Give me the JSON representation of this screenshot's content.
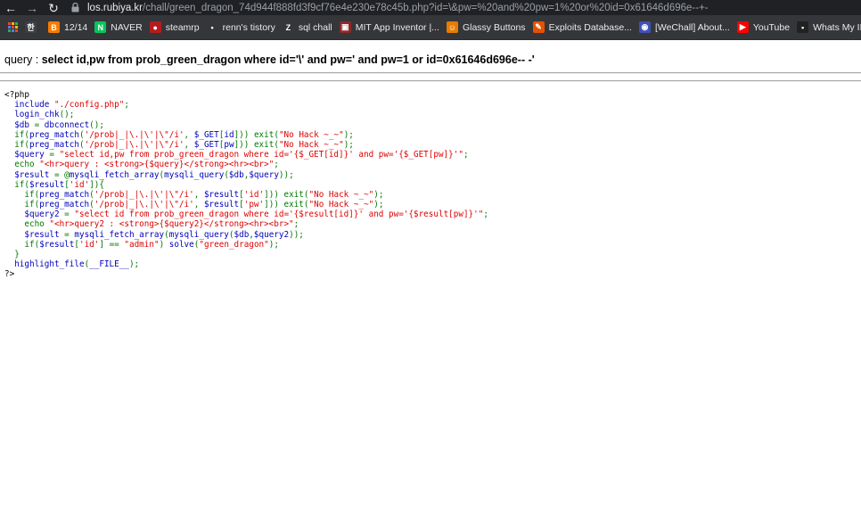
{
  "browser": {
    "url_host": "los.rubiya.kr",
    "url_rest": "/chall/green_dragon_74d944f888fd3f9cf76e4e230e78c45b.php?id=\\&pw=%20and%20pw=1%20or%20id=0x61646d696e--+-",
    "bookmarks": [
      {
        "label": "",
        "icon": "apps-grid-icon"
      },
      {
        "label": "",
        "icon": "korean-icon",
        "glyph": "한",
        "color": "#3c4043"
      },
      {
        "label": "12/14",
        "icon": "blogger-icon",
        "glyph": "B",
        "color": "#f57c00"
      },
      {
        "label": "NAVER",
        "icon": "naver-icon",
        "glyph": "N",
        "color": "#03c75a"
      },
      {
        "label": "steamrp",
        "icon": "steam-icon",
        "glyph": "●",
        "color": "#b71c1c"
      },
      {
        "label": "renn's tistory",
        "icon": "tistory-icon",
        "glyph": "•",
        "color": "#35363a"
      },
      {
        "label": "sql chall",
        "icon": "z-icon",
        "glyph": "Z",
        "color": "#35363a"
      },
      {
        "label": "MIT App Inventor |...",
        "icon": "mit-icon",
        "glyph": "▣",
        "color": "#8e2a2a"
      },
      {
        "label": "Glassy Buttons",
        "icon": "glassy-icon",
        "glyph": "☺",
        "color": "#e67c00"
      },
      {
        "label": "Exploits Database...",
        "icon": "exploitdb-icon",
        "glyph": "✎",
        "color": "#e65100"
      },
      {
        "label": "[WeChall] About...",
        "icon": "wechall-icon",
        "glyph": "◉",
        "color": "#3f51b5"
      },
      {
        "label": "YouTube",
        "icon": "youtube-icon",
        "glyph": "▶",
        "color": "#ff0000"
      },
      {
        "label": "Whats My IP Addr...",
        "icon": "whatsmyip-icon",
        "glyph": "▪",
        "color": "#212121"
      }
    ]
  },
  "page": {
    "query_prefix": "query : ",
    "query_sql": "select id,pw from prob_green_dragon where id='\\' and pw=' and pw=1 or id=0x61646d696e-- -'",
    "source_lines": [
      [
        [
          "tag",
          "<?php"
        ]
      ],
      [
        [
          "def",
          "  include "
        ],
        [
          "str",
          "\"./config.php\""
        ],
        [
          "kw",
          ";"
        ]
      ],
      [
        [
          "def",
          "  login_chk"
        ],
        [
          "kw",
          "();"
        ]
      ],
      [
        [
          "def",
          "  $db "
        ],
        [
          "kw",
          "= "
        ],
        [
          "def",
          "dbconnect"
        ],
        [
          "kw",
          "();"
        ]
      ],
      [
        [
          "kw",
          "  if("
        ],
        [
          "def",
          "preg_match"
        ],
        [
          "kw",
          "("
        ],
        [
          "str",
          "'/prob|_|\\.|\\'|\\\"/i'"
        ],
        [
          "kw",
          ", "
        ],
        [
          "def",
          "$_GET"
        ],
        [
          "kw",
          "["
        ],
        [
          "def",
          "id"
        ],
        [
          "kw",
          "])) exit("
        ],
        [
          "str",
          "\"No Hack ~_~\""
        ],
        [
          "kw",
          ");"
        ]
      ],
      [
        [
          "kw",
          "  if("
        ],
        [
          "def",
          "preg_match"
        ],
        [
          "kw",
          "("
        ],
        [
          "str",
          "'/prob|_|\\.|\\'|\\\"/i'"
        ],
        [
          "kw",
          ", "
        ],
        [
          "def",
          "$_GET"
        ],
        [
          "kw",
          "["
        ],
        [
          "def",
          "pw"
        ],
        [
          "kw",
          "])) exit("
        ],
        [
          "str",
          "\"No Hack ~_~\""
        ],
        [
          "kw",
          ");"
        ]
      ],
      [
        [
          "def",
          "  $query "
        ],
        [
          "kw",
          "= "
        ],
        [
          "str",
          "\"select id,pw from prob_green_dragon where id='{$_GET[id]}' and pw='{$_GET[pw]}'\""
        ],
        [
          "kw",
          ";"
        ]
      ],
      [
        [
          "kw",
          "  echo "
        ],
        [
          "str",
          "\"<hr>query : <strong>{$query}</strong><hr><br>\""
        ],
        [
          "kw",
          ";"
        ]
      ],
      [
        [
          "def",
          "  $result "
        ],
        [
          "kw",
          "= @"
        ],
        [
          "def",
          "mysqli_fetch_array"
        ],
        [
          "kw",
          "("
        ],
        [
          "def",
          "mysqli_query"
        ],
        [
          "kw",
          "("
        ],
        [
          "def",
          "$db"
        ],
        [
          "kw",
          ","
        ],
        [
          "def",
          "$query"
        ],
        [
          "kw",
          "));"
        ]
      ],
      [
        [
          "kw",
          "  if("
        ],
        [
          "def",
          "$result"
        ],
        [
          "kw",
          "["
        ],
        [
          "str",
          "'id'"
        ],
        [
          "kw",
          "]){"
        ]
      ],
      [
        [
          "kw",
          "    if("
        ],
        [
          "def",
          "preg_match"
        ],
        [
          "kw",
          "("
        ],
        [
          "str",
          "'/prob|_|\\.|\\'|\\\"/i'"
        ],
        [
          "kw",
          ", "
        ],
        [
          "def",
          "$result"
        ],
        [
          "kw",
          "["
        ],
        [
          "str",
          "'id'"
        ],
        [
          "kw",
          "])) exit("
        ],
        [
          "str",
          "\"No Hack ~_~\""
        ],
        [
          "kw",
          ");"
        ]
      ],
      [
        [
          "kw",
          "    if("
        ],
        [
          "def",
          "preg_match"
        ],
        [
          "kw",
          "("
        ],
        [
          "str",
          "'/prob|_|\\.|\\'|\\\"/i'"
        ],
        [
          "kw",
          ", "
        ],
        [
          "def",
          "$result"
        ],
        [
          "kw",
          "["
        ],
        [
          "str",
          "'pw'"
        ],
        [
          "kw",
          "])) exit("
        ],
        [
          "str",
          "\"No Hack ~_~\""
        ],
        [
          "kw",
          ");"
        ]
      ],
      [
        [
          "def",
          "    $query2 "
        ],
        [
          "kw",
          "= "
        ],
        [
          "str",
          "\"select id from prob_green_dragon where id='{$result[id]}' and pw='{$result[pw]}'\""
        ],
        [
          "kw",
          ";"
        ]
      ],
      [
        [
          "kw",
          "    echo "
        ],
        [
          "str",
          "\"<hr>query2 : <strong>{$query2}</strong><hr><br>\""
        ],
        [
          "kw",
          ";"
        ]
      ],
      [
        [
          "def",
          "    $result "
        ],
        [
          "kw",
          "= "
        ],
        [
          "def",
          "mysqli_fetch_array"
        ],
        [
          "kw",
          "("
        ],
        [
          "def",
          "mysqli_query"
        ],
        [
          "kw",
          "("
        ],
        [
          "def",
          "$db"
        ],
        [
          "kw",
          ","
        ],
        [
          "def",
          "$query2"
        ],
        [
          "kw",
          "));"
        ]
      ],
      [
        [
          "kw",
          "    if("
        ],
        [
          "def",
          "$result"
        ],
        [
          "kw",
          "["
        ],
        [
          "str",
          "'id'"
        ],
        [
          "kw",
          "] == "
        ],
        [
          "str",
          "\"admin\""
        ],
        [
          "kw",
          ") "
        ],
        [
          "def",
          "solve"
        ],
        [
          "kw",
          "("
        ],
        [
          "str",
          "\"green_dragon\""
        ],
        [
          "kw",
          ");"
        ]
      ],
      [
        [
          "kw",
          "  }"
        ]
      ],
      [
        [
          "def",
          "  highlight_file"
        ],
        [
          "kw",
          "("
        ],
        [
          "def",
          "__FILE__"
        ],
        [
          "kw",
          ");"
        ]
      ],
      [
        [
          "tag",
          "?>"
        ]
      ]
    ]
  }
}
